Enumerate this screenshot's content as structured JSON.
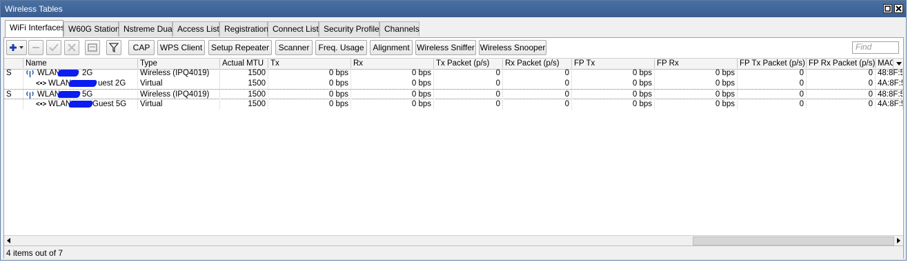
{
  "window": {
    "title": "Wireless Tables"
  },
  "tabs": [
    {
      "label": "WiFi Interfaces"
    },
    {
      "label": "W60G Station"
    },
    {
      "label": "Nstreme Dual"
    },
    {
      "label": "Access List"
    },
    {
      "label": "Registration"
    },
    {
      "label": "Connect List"
    },
    {
      "label": "Security Profiles"
    },
    {
      "label": "Channels"
    }
  ],
  "toolbar": {
    "add_icon": "plus-icon",
    "buttons": [
      "CAP",
      "WPS Client",
      "Setup Repeater",
      "Scanner",
      "Freq. Usage",
      "Alignment",
      "Wireless Sniffer",
      "Wireless Snooper"
    ],
    "find_placeholder": "Find"
  },
  "columns": [
    "Name",
    "Type",
    "Actual MTU",
    "Tx",
    "Rx",
    "Tx Packet (p/s)",
    "Rx Packet (p/s)",
    "FP Tx",
    "FP Rx",
    "FP Tx Packet (p/s)",
    "FP Rx Packet (p/s)",
    "MAC"
  ],
  "rows": [
    {
      "flag": "S",
      "name_a": "WLAN",
      "name_b": "2G",
      "type": "Wireless (IPQ4019)",
      "mtu": "1500",
      "tx": "0 bps",
      "rx": "0 bps",
      "txp": "0",
      "rxp": "0",
      "fptx": "0 bps",
      "fprx": "0 bps",
      "fptxp": "0",
      "fprxp": "0",
      "mac": "48:8F:5"
    },
    {
      "flag": "",
      "name_a": "WLAN",
      "name_b": "uest 2G",
      "type": "Virtual",
      "mtu": "1500",
      "tx": "0 bps",
      "rx": "0 bps",
      "txp": "0",
      "rxp": "0",
      "fptx": "0 bps",
      "fprx": "0 bps",
      "fptxp": "0",
      "fprxp": "0",
      "mac": "4A:8F:5"
    },
    {
      "flag": "S",
      "name_a": "WLAN",
      "name_b": "5G",
      "type": "Wireless (IPQ4019)",
      "mtu": "1500",
      "tx": "0 bps",
      "rx": "0 bps",
      "txp": "0",
      "rxp": "0",
      "fptx": "0 bps",
      "fprx": "0 bps",
      "fptxp": "0",
      "fprxp": "0",
      "mac": "48:8F:5"
    },
    {
      "flag": "",
      "name_a": "WLAN",
      "name_b": "Guest 5G",
      "type": "Virtual",
      "mtu": "1500",
      "tx": "0 bps",
      "rx": "0 bps",
      "txp": "0",
      "rxp": "0",
      "fptx": "0 bps",
      "fprx": "0 bps",
      "fptxp": "0",
      "fprxp": "0",
      "mac": "4A:8F:5"
    }
  ],
  "status": {
    "text": "4 items out of 7"
  },
  "colors": {
    "title_bar": "#3f6598",
    "redaction": "#0a1cf0"
  }
}
